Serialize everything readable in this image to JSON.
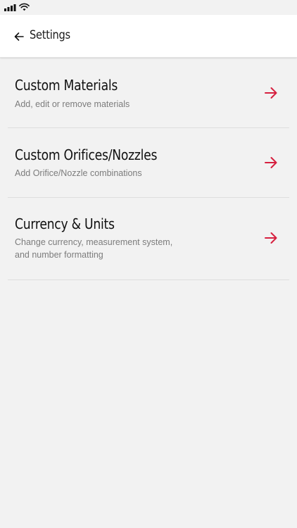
{
  "header": {
    "title": "Settings",
    "back_icon": "arrow-left-icon"
  },
  "status_bar": {
    "icons": [
      "signal-icon",
      "wifi-icon"
    ]
  },
  "settings_items": [
    {
      "title": "Custom Materials",
      "subtitle": "Add, edit or remove materials",
      "icon": "arrow-right-icon"
    },
    {
      "title": "Custom Orifices/Nozzles",
      "subtitle": "Add Orifice/Nozzle combinations",
      "icon": "arrow-right-icon"
    },
    {
      "title": "Currency & Units",
      "subtitle": "Change currency, measurement system, and number formatting",
      "icon": "arrow-right-icon"
    }
  ],
  "colors": {
    "accent": "#d6203f",
    "background": "#f2f2f2",
    "app_bar": "#ffffff"
  }
}
